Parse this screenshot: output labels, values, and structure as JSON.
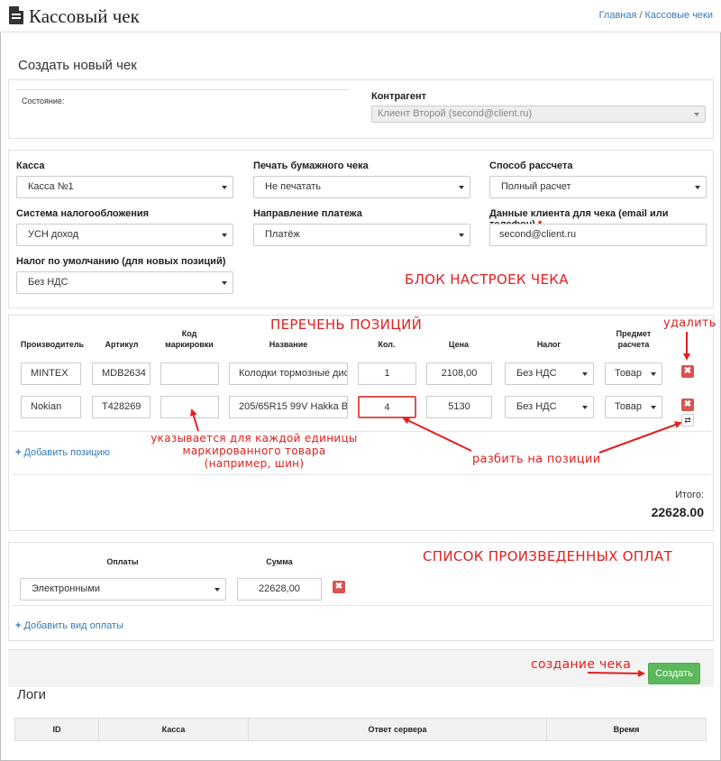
{
  "header": {
    "title": "Кассовый чек",
    "breadcrumb_home": "Главная",
    "breadcrumb_sep": "/",
    "breadcrumb_current": "Кассовые чеки"
  },
  "subtitle": "Создать новый чек",
  "top_panel": {
    "state_label": "Состояние:",
    "contractor_label": "Контрагент",
    "contractor_value": "Клиент Второй (second@client.ru)"
  },
  "settings": {
    "kassa_label": "Касса",
    "kassa_value": "Касса №1",
    "print_label": "Печать бумажного чека",
    "print_value": "Не печатать",
    "payment_method_label": "Способ рассчета",
    "payment_method_value": "Полный расчет",
    "tax_system_label": "Система налогообложения",
    "tax_system_value": "УСН доход",
    "direction_label": "Направление платежа",
    "direction_value": "Платёж",
    "client_data_label": "Данные клиента для чека (email или телефон)",
    "client_data_required": "*",
    "client_data_value": "second@client.ru",
    "default_tax_label": "Налог по умолчанию (для новых позиций)",
    "default_tax_value": "Без НДС"
  },
  "positions": {
    "headers": {
      "manufacturer": "Производитель",
      "article": "Артикул",
      "marking_1": "Код",
      "marking_2": "маркировки",
      "name": "Название",
      "qty": "Кол.",
      "price": "Цена",
      "tax": "Налог",
      "subject_1": "Предмет",
      "subject_2": "расчета"
    },
    "rows": [
      {
        "manufacturer": "MINTEX",
        "article": "MDB2634",
        "marking": "",
        "name": "Колодки тормозные дис",
        "qty": "1",
        "price": "2108,00",
        "tax": "Без НДС",
        "subject": "Товар"
      },
      {
        "manufacturer": "Nokian",
        "article": "T428269",
        "marking": "",
        "name": "205/65R15 99V Hakka Bl",
        "qty": "4",
        "price": "5130",
        "tax": "Без НДС",
        "subject": "Товар"
      }
    ],
    "add_label": "Добавить позицию",
    "total_label": "Итого:",
    "total_value": "22628.00"
  },
  "payments": {
    "type_header": "Оплаты",
    "sum_header": "Сумма",
    "type_value": "Электронными",
    "sum_value": "22628,00",
    "add_label": "Добавить вид оплаты"
  },
  "create_button": "Создать",
  "logs": {
    "title": "Логи",
    "columns": [
      "ID",
      "Касса",
      "Ответ сервера",
      "Время"
    ]
  },
  "annotations": {
    "settings_block": "БЛОК НАСТРОЕК ЧЕКА",
    "positions_list": "ПЕРЕЧЕНЬ ПОЗИЦИЙ",
    "delete": "удалить",
    "marking_note_1": "указывается для каждой единицы",
    "marking_note_2": "маркированного товара",
    "marking_note_3": "(например, шин)",
    "split": "разбить на позиции",
    "payments_list": "СПИСОК ПРОИЗВЕДЕННЫХ ОПЛАТ",
    "create_check": "создание чека"
  },
  "colors": {
    "accent": "#337ab7",
    "annotation": "#e02020",
    "danger": "#d9534f",
    "success": "#5cb85c"
  }
}
